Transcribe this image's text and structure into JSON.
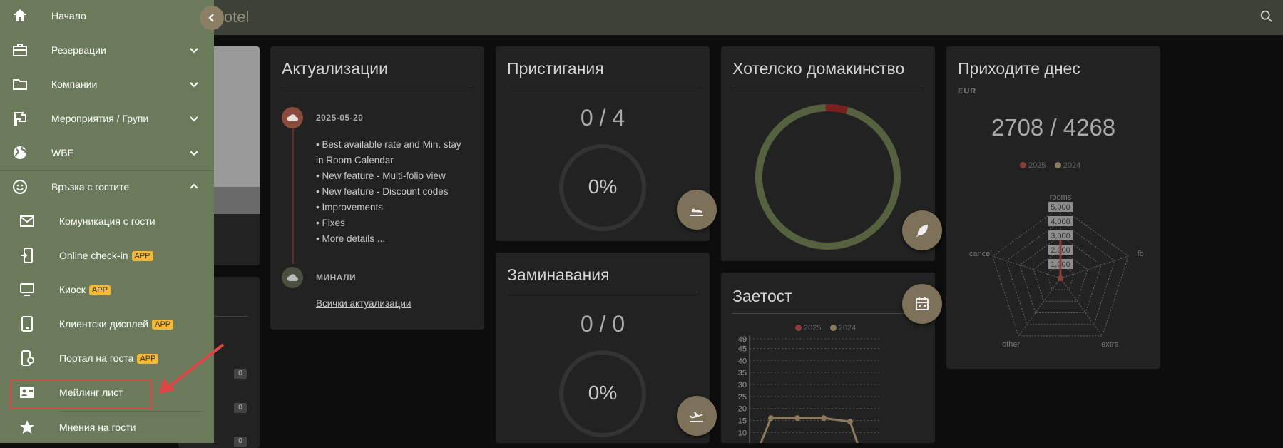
{
  "header": {
    "title": "Hotel"
  },
  "sidebar": {
    "items": [
      {
        "label": "Начало"
      },
      {
        "label": "Резервации"
      },
      {
        "label": "Компании"
      },
      {
        "label": "Мероприятия / Групи"
      },
      {
        "label": "WBE"
      },
      {
        "label": "Връзка с гостите"
      }
    ],
    "sub_items": [
      {
        "label": "Комуникация с гости"
      },
      {
        "label": "Online check-in",
        "badge": "APP"
      },
      {
        "label": "Киоск",
        "badge": "APP"
      },
      {
        "label": "Клиентски дисплей",
        "badge": "APP"
      },
      {
        "label": "Портал на госта",
        "badge": "APP"
      },
      {
        "label": "Мейлинг лист"
      },
      {
        "label": "Мнения на гости"
      }
    ]
  },
  "zero_badges": [
    "0",
    "0",
    "0"
  ],
  "updates": {
    "title": "Актуализации",
    "date": "2025-05-20",
    "items": [
      "• Best available rate and Min. stay",
      "in Room Calendar",
      "• New feature - Multi-folio view",
      "• New feature - Discount codes",
      "• Improvements",
      "• Fixes"
    ],
    "more_prefix": "• ",
    "more_link": "More details ...",
    "past_label": "МИНАЛИ",
    "all_link": "Всички актуализации"
  },
  "arrivals": {
    "title": "Пристигания",
    "count": "0 / 4",
    "percent": "0%",
    "progress": 0
  },
  "departures": {
    "title": "Заминавания",
    "count": "0 / 0",
    "percent": "0%",
    "progress": 0
  },
  "housekeeping": {
    "title": "Хотелско домакинство",
    "done_fraction": 0.05
  },
  "occupancy": {
    "title": "Заетост",
    "legend": [
      "2025",
      "2024"
    ]
  },
  "revenue": {
    "title": "Приходите днес",
    "currency": "EUR",
    "value": "2708 / 4268",
    "legend": [
      "2025",
      "2024"
    ]
  },
  "chart_data": [
    {
      "type": "line",
      "title": "Заетост",
      "series": [
        {
          "name": "2025",
          "values": []
        },
        {
          "name": "2024",
          "values": [
            16,
            16,
            16,
            14.5
          ]
        }
      ],
      "ylim": [
        0,
        49
      ],
      "yticks": [
        "49",
        "45",
        "40",
        "35",
        "30",
        "25",
        "20",
        "15",
        "10"
      ],
      "grid": true,
      "legend": "top"
    },
    {
      "type": "radar",
      "title": "Приходите днес",
      "axes": [
        "rooms",
        "fb",
        "extra",
        "other",
        "cancel"
      ],
      "ticks": [
        "5,000",
        "4,000",
        "3,000",
        "2,000",
        "1,000"
      ],
      "series": [
        {
          "name": "2025",
          "values": [
            2708,
            0,
            0,
            0,
            0
          ]
        },
        {
          "name": "2024",
          "values": [
            0,
            0,
            0,
            0,
            0
          ]
        }
      ],
      "rmax": 5000,
      "legend": "top"
    }
  ],
  "colors": {
    "sidebar_bg": "#6b7a5a",
    "header_bg": "#3d4136",
    "accent_2025": "#8a3e35",
    "accent_2024": "#8a7a5a",
    "housekeeping_ring": "#56623f",
    "housekeeping_done": "#7a1f1f",
    "badge_app": "#f3b93a",
    "highlight": "#e04545"
  }
}
